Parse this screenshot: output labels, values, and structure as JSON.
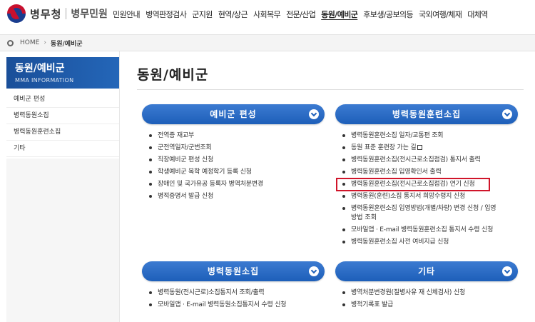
{
  "header": {
    "org_name": "병무청",
    "sub_name": "병무민원",
    "nav": [
      "민원안내",
      "병역판정검사",
      "군지원",
      "현역/상근",
      "사회복무",
      "전문/산업",
      "동원/예비군",
      "후보생/공보의등",
      "국외여행/체재",
      "대체역"
    ],
    "active_nav_index": 6
  },
  "breadcrumb": {
    "home": "HOME",
    "current": "동원/예비군"
  },
  "sidebar": {
    "title": "동원/예비군",
    "subtitle": "MMA INFORMATION",
    "items": [
      "예비군 편성",
      "병력동원소집",
      "병력동원훈련소집",
      "기타"
    ]
  },
  "main": {
    "title": "동원/예비군",
    "panels": [
      {
        "title": "예비군 편성",
        "links": [
          "전역증 재교부",
          "군전역일자/군번조회",
          "직장예비군 편성 신청",
          "학생예비군 복학 예정학기 등록 신청",
          "장애인 및 국가유공 등록자 병역처분변경",
          "병적증명서 발급 신청"
        ]
      },
      {
        "title": "병력동원훈련소집",
        "links": [
          "병력동원훈련소집 일자/교통편 조회",
          "동원 표준 훈련장 가는 길",
          "병력동원훈련소집(전시근로소집점검) 통지서 출력",
          "병력동원훈련소집 입영확인서 출력",
          "병력동원훈련소집(전시근로소집점검) 연기 신청",
          "병력동원(훈련)소집 통지서 희망수령지 신청",
          "병력동원훈련소집 입영방법(개별/차량) 변경 신청 / 입영",
          "방법 조회",
          "모바일앱 · E-mail 병력동원훈련소집 통지서 수령 신청",
          "병력동원훈련소집 사전 여비지급 신청"
        ],
        "highlight_index": 4
      },
      {
        "title": "병력동원소집",
        "links": [
          "병력동원(전시근로)소집통지서 조회/출력",
          "모바일앱 · E-mail 병력동원소집통지서 수령 신청"
        ]
      },
      {
        "title": "기타",
        "links": [
          "병역처분변경원(질병사유 재 신체검사) 신청",
          "병적기록표 발급"
        ]
      }
    ]
  },
  "colors": {
    "accent": "#1d5fb9",
    "highlight": "#d0152a"
  }
}
